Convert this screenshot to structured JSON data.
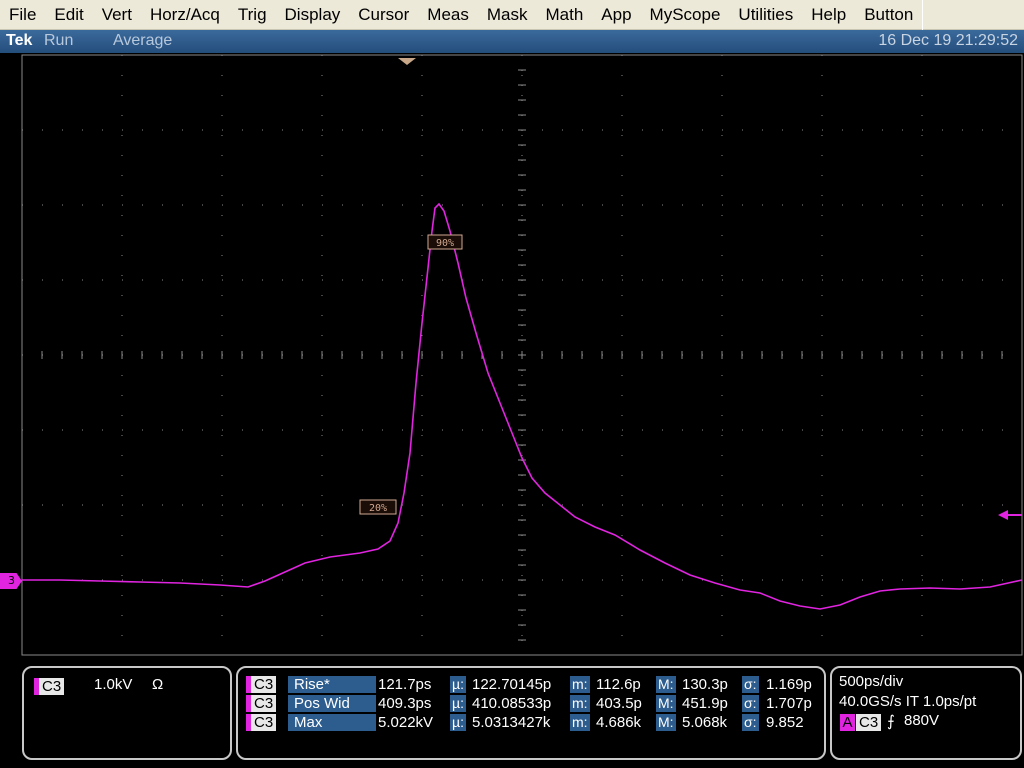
{
  "menu": [
    "File",
    "Edit",
    "Vert",
    "Horz/Acq",
    "Trig",
    "Display",
    "Cursor",
    "Meas",
    "Mask",
    "Math",
    "App",
    "MyScope",
    "Utilities",
    "Help",
    "Button"
  ],
  "status": {
    "brand": "Tek",
    "run_state": "Run",
    "acq_mode": "Average",
    "datetime": "16 Dec 19 21:29:52"
  },
  "screen": {
    "channel_marker": "3",
    "ref_labels": {
      "upper": "90%",
      "lower": "20%"
    },
    "colors": {
      "trace": "#e024e0",
      "grid": "#8a8a8a",
      "ref": "#d0a890"
    }
  },
  "vertical": {
    "channel": "C3",
    "scale": "1.0kV",
    "coupling": "Ω"
  },
  "measurements": [
    {
      "ch": "C3",
      "name": "Rise*",
      "value": "121.7ps",
      "mean_k": "µ:",
      "mean": "122.70145p",
      "min_k": "m:",
      "min": "112.6p",
      "max_k": "M:",
      "max": "130.3p",
      "sd_k": "σ:",
      "sd": "1.169p"
    },
    {
      "ch": "C3",
      "name": "Pos Wid",
      "value": "409.3ps",
      "mean_k": "µ:",
      "mean": "410.08533p",
      "min_k": "m:",
      "min": "403.5p",
      "max_k": "M:",
      "max": "451.9p",
      "sd_k": "σ:",
      "sd": "1.707p"
    },
    {
      "ch": "C3",
      "name": "Max",
      "value": "5.022kV",
      "mean_k": "µ:",
      "mean": "5.0313427k",
      "min_k": "m:",
      "min": "4.686k",
      "max_k": "M:",
      "max": "5.068k",
      "sd_k": "σ:",
      "sd": "9.852"
    }
  ],
  "horizontal": {
    "timebase": "500ps/div",
    "sample": "40.0GS/s IT 1.0ps/pt",
    "trig_source_label": "A",
    "trig_channel": "C3",
    "trig_slope": "⨍",
    "trig_level": "880V"
  }
}
